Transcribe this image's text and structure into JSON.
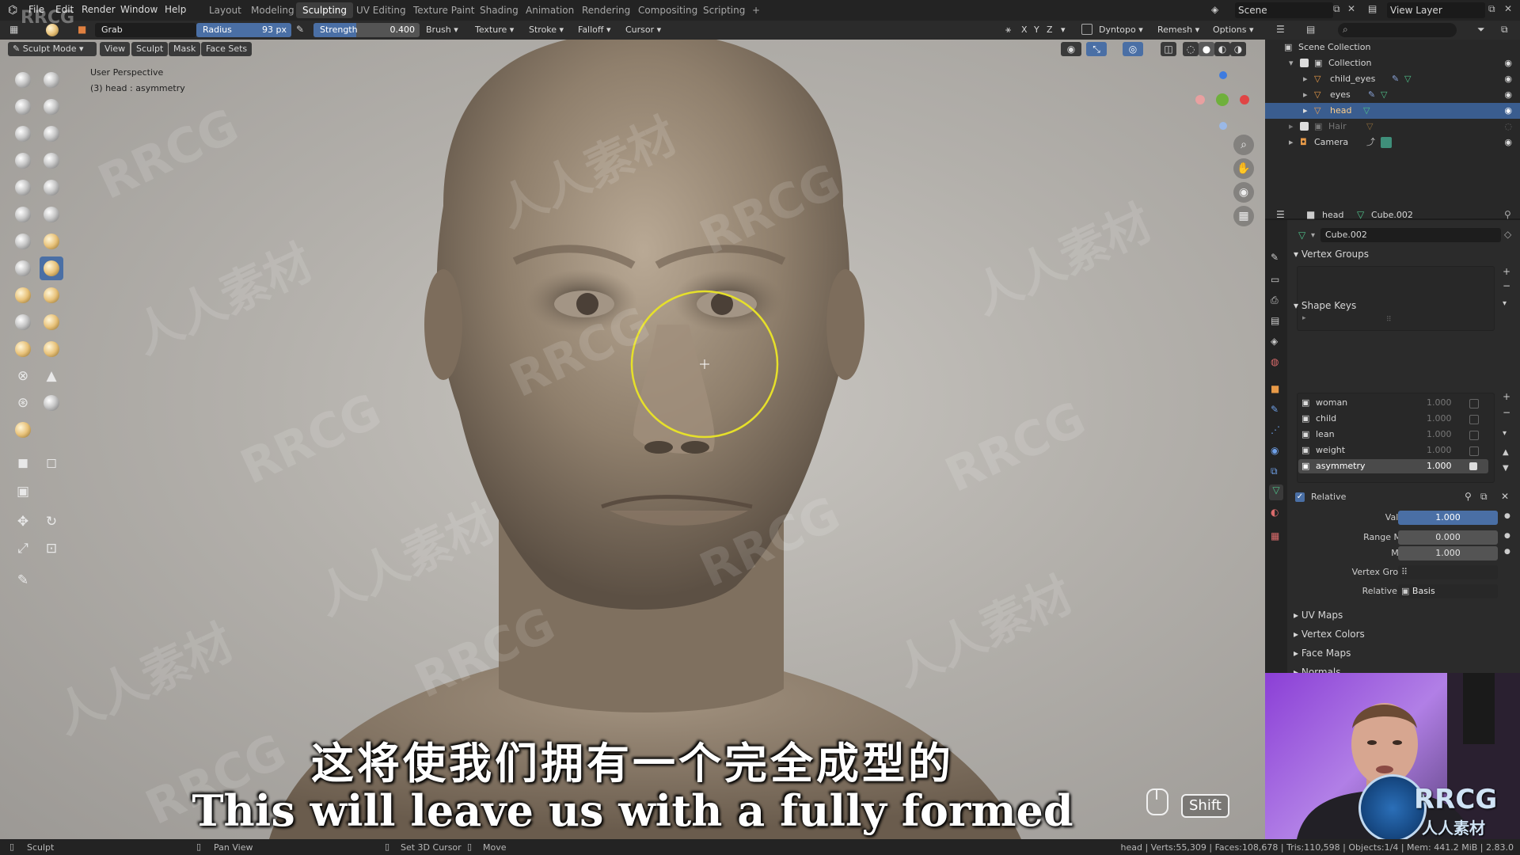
{
  "menubar": {
    "items": [
      "File",
      "Edit",
      "Render",
      "Window",
      "Help"
    ],
    "workspaces": [
      "Layout",
      "Modeling",
      "Sculpting",
      "UV Editing",
      "Texture Paint",
      "Shading",
      "Animation",
      "Rendering",
      "Compositing",
      "Scripting"
    ],
    "active_workspace": "Sculpting",
    "add_tab": "+",
    "scene_label": "Scene",
    "view_layer_label": "View Layer"
  },
  "toolheader": {
    "brush_name": "Grab",
    "radius_label": "Radius",
    "radius_value": "93 px",
    "strength_label": "Strength",
    "strength_value": "0.400",
    "dropdowns": [
      "Brush",
      "Texture",
      "Stroke",
      "Falloff",
      "Cursor"
    ],
    "axis": [
      "X",
      "Y",
      "Z"
    ],
    "dyntopo": "Dyntopo",
    "remesh": "Remesh",
    "options": "Options"
  },
  "viewheader": {
    "mode": "Sculpt Mode",
    "menus": [
      "View",
      "Sculpt",
      "Mask",
      "Face Sets"
    ]
  },
  "viewport": {
    "perspective": "User Perspective",
    "object_info": "(3) head : asymmetry"
  },
  "outliner": {
    "root": "Scene Collection",
    "collection": "Collection",
    "items": [
      "child_eyes",
      "eyes",
      "head",
      "Hair",
      "Camera"
    ],
    "selected": "head"
  },
  "properties": {
    "object_name": "head",
    "mesh_name": "Cube.002",
    "data_name": "Cube.002",
    "vertex_groups_title": "Vertex Groups",
    "shape_keys_title": "Shape Keys",
    "shape_keys": [
      {
        "name": "woman",
        "value": "1.000"
      },
      {
        "name": "child",
        "value": "1.000"
      },
      {
        "name": "lean",
        "value": "1.000"
      },
      {
        "name": "weight",
        "value": "1.000"
      },
      {
        "name": "asymmetry",
        "value": "1.000"
      }
    ],
    "relative_label": "Relative",
    "value_label": "Value",
    "value": "1.000",
    "range_min_label": "Range Min",
    "range_min": "0.000",
    "max_label": "Max",
    "max": "1.000",
    "vertex_group_label": "Vertex Group",
    "relative_to_label": "Relative To",
    "relative_to": "Basis",
    "collapsed_panels": [
      "UV Maps",
      "Vertex Colors",
      "Face Maps",
      "Normals"
    ]
  },
  "statusbar": {
    "left_mode": "Sculpt",
    "pan_view": "Pan View",
    "set_cursor": "Set 3D Cursor",
    "move": "Move",
    "stats": "head | Verts:55,309 | Faces:108,678 | Tris:110,598 | Objects:1/4 | Mem: 441.2 MiB | 2.83.0"
  },
  "subtitles": {
    "chinese": "这将使我们拥有一个完全成型的",
    "english": "This will leave us with a fully formed"
  },
  "overlay": {
    "key_hint": "Shift",
    "brand_top": "RRCG",
    "brand_logo": "RRCG",
    "brand_logo_sub": "人人素材",
    "watermark_text": "RRCG",
    "watermark_cn": "人人素材"
  },
  "colors": {
    "accent": "#4a6fa5",
    "selection": "#3a5d8f",
    "brush_circle": "#e6e02a",
    "axis_x": "#e04545",
    "axis_y": "#6fb03c",
    "axis_z": "#3d7be0"
  }
}
